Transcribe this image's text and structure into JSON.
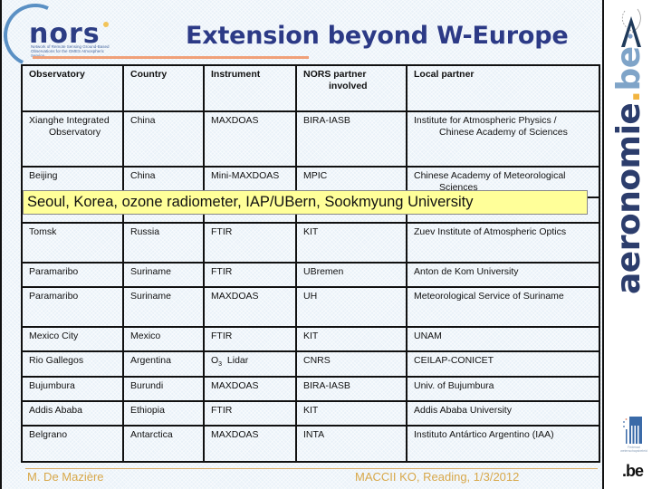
{
  "header": {
    "title": "Extension beyond W-Europe",
    "logo_word": "nors",
    "logo_subtitle": "Network of Remote Sensing Ground-Based Observations for the GMES Atmospheric Service"
  },
  "table": {
    "columns": [
      "Observatory",
      "Country",
      "Instrument",
      "NORS partner involved",
      "Local partner"
    ],
    "header_lines": {
      "nors_partner_line1": "NORS partner",
      "nors_partner_line2": "involved"
    },
    "rows": [
      {
        "observatory": "Xianghe Integrated",
        "observatory_line2": "Observatory",
        "country": "China",
        "instrument": "MAXDOAS",
        "nors_partner": "BIRA-IASB",
        "local_partner": "Institute for Atmospheric Physics /",
        "local_partner_line2": "Chinese Academy of Sciences"
      },
      {
        "observatory": "Beijing",
        "country": "China",
        "instrument": "Mini-MAXDOAS",
        "nors_partner": "MPIC",
        "local_partner": "Chinese Academy of Meteorological",
        "local_partner_line2": "Sciences"
      },
      {
        "observatory": "",
        "country": "",
        "instrument": "",
        "nors_partner": "",
        "local_partner": ""
      },
      {
        "observatory": "Tomsk",
        "country": "Russia",
        "instrument": "FTIR",
        "nors_partner": "KIT",
        "local_partner": "Zuev Institute of Atmospheric Optics"
      },
      {
        "observatory": "Paramaribo",
        "country": "Suriname",
        "instrument": "FTIR",
        "nors_partner": "UBremen",
        "local_partner": "Anton de Kom University"
      },
      {
        "observatory": "Paramaribo",
        "country": "Suriname",
        "instrument": "MAXDOAS",
        "nors_partner": "UH",
        "local_partner": "Meteorological Service of Suriname"
      },
      {
        "observatory": "Mexico City",
        "country": "Mexico",
        "instrument": "FTIR",
        "nors_partner": "KIT",
        "local_partner": "UNAM"
      },
      {
        "observatory": "Rio Gallegos",
        "country": "Argentina",
        "instrument_prefix": "O",
        "instrument_sub": "3",
        "instrument": "Lidar",
        "nors_partner": "CNRS",
        "local_partner": "CEILAP-CONICET"
      },
      {
        "observatory": "Bujumbura",
        "country": "Burundi",
        "instrument": "MAXDOAS",
        "nors_partner": "BIRA-IASB",
        "local_partner": "Univ. of Bujumbura"
      },
      {
        "observatory": "Addis Ababa",
        "country": "Ethiopia",
        "instrument": "FTIR",
        "nors_partner": "KIT",
        "local_partner": "Addis Ababa University"
      },
      {
        "observatory": "Belgrano",
        "country": "Antarctica",
        "instrument": "MAXDOAS",
        "nors_partner": "INTA",
        "local_partner": "Instituto Antártico Argentino (IAA)"
      }
    ]
  },
  "callout": {
    "text": "Seoul, Korea, ozone radiometer, IAP/UBern, Sookmyung University"
  },
  "footer": {
    "author": "M. De Mazière",
    "event": "MACCII KO, Reading, 1/3/2012"
  },
  "sidebar": {
    "brand_main": "aeronomie",
    "brand_dot": ".",
    "brand_tld": "be",
    "fed_text": "Federaal wetenschapsbeleid",
    "dotbe_text": ".be"
  },
  "colors": {
    "title": "#2c3a86",
    "accent_rule": "#f0a078",
    "callout_bg": "#ffff99",
    "footer_text": "#d8a84a",
    "brand_dark": "#2c3d6c",
    "brand_dot": "#f2b440"
  }
}
